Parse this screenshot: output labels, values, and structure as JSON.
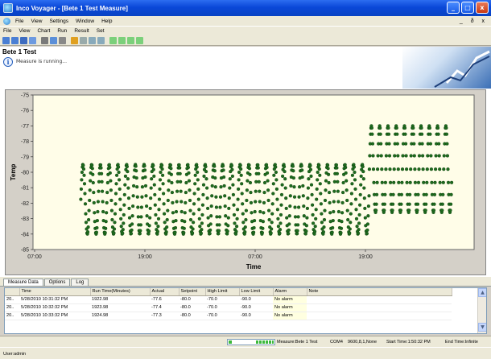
{
  "window": {
    "title": "Inco Voyager - [Bete 1 Test  Measure]",
    "minimize": "_",
    "maximize": "□",
    "close": "x"
  },
  "menu1": {
    "items": [
      "File",
      "View",
      "Settings",
      "Window",
      "Help"
    ],
    "mdi_controls": "_ ð x"
  },
  "menu2": {
    "items": [
      "File",
      "View",
      "Chart",
      "Run",
      "Result",
      "Set"
    ]
  },
  "toolbar": {
    "buttons": [
      {
        "icon": "new-icon",
        "color": "#4a7fd4"
      },
      {
        "icon": "open-icon",
        "color": "#4a7fd4"
      },
      {
        "icon": "save-icon",
        "color": "#3e6cc0"
      },
      {
        "icon": "doc-icon",
        "color": "#6d9ae0"
      },
      {
        "icon": "print-icon",
        "color": "#7a7a7a"
      },
      {
        "icon": "preview-icon",
        "color": "#5b8fd8"
      },
      {
        "icon": "cut-icon",
        "color": "#888"
      },
      {
        "icon": "chart-icon",
        "color": "#e0a020"
      },
      {
        "icon": "tool-icon",
        "color": "#9aa"
      },
      {
        "icon": "zoom-icon",
        "color": "#8ab"
      },
      {
        "icon": "magnify-icon",
        "color": "#8ab"
      },
      {
        "icon": "play-icon",
        "color": "#7bd07b"
      },
      {
        "icon": "step-icon",
        "color": "#7bd07b"
      },
      {
        "icon": "flag-icon",
        "color": "#7bd07b"
      },
      {
        "icon": "stop-icon",
        "color": "#7bd07b"
      }
    ]
  },
  "header": {
    "title": "Bete 1 Test",
    "status": "Measure is running..."
  },
  "chart_data": {
    "type": "scatter",
    "title": "",
    "xlabel": "Time",
    "ylabel": "Temp",
    "x_ticks": [
      "07:00",
      "19:00",
      "07:00",
      "19:00"
    ],
    "y_ticks": [
      -75,
      -76,
      -77,
      -78,
      -79,
      -80,
      -81,
      -82,
      -83,
      -84,
      -85
    ],
    "ylim": [
      -85,
      -75
    ],
    "x_domain_hours": [
      0,
      48
    ],
    "series_color": "#1e6b1e",
    "phases": [
      {
        "start_hour": 5.2,
        "end_hour": 36.6,
        "cycle_hours": 0.95,
        "low": -84.0,
        "high": -79.5
      },
      {
        "start_hour": 36.6,
        "end_hour": 45.6,
        "cycle_hours": 0.9,
        "low": -82.6,
        "high": -77.0
      }
    ],
    "grid": false,
    "background": "#fffde8"
  },
  "tabs": [
    "Measure Data",
    "Options",
    "Log"
  ],
  "table": {
    "columns": [
      "",
      "Time",
      "Run Time(Minutes)",
      "Actual",
      "Setpoint",
      "High Limit",
      "Low Limit",
      "Alarm",
      "Note"
    ],
    "rows": [
      [
        "20..",
        "5/28/2010 10:31:32 PM",
        "1922.98",
        "-77.6",
        "-80.0",
        "-70.0",
        "-90.0",
        "No alarm",
        ""
      ],
      [
        "20..",
        "5/28/2010 10:32:32 PM",
        "1923.98",
        "-77.4",
        "-80.0",
        "-70.0",
        "-90.0",
        "No alarm",
        ""
      ],
      [
        "20..",
        "5/28/2010 10:33:32 PM",
        "1924.98",
        "-77.3",
        "-80.0",
        "-70.0",
        "-90.0",
        "No alarm",
        ""
      ]
    ]
  },
  "statusbar": {
    "progress": 0.38,
    "measure": "Measure:Bete 1 Test",
    "com": "COM4",
    "port": "9600,8,1,None",
    "start": "Start Time:1:50:32 PM",
    "end": "End Time:Infinite"
  },
  "userbar": {
    "user": "User:admin"
  }
}
